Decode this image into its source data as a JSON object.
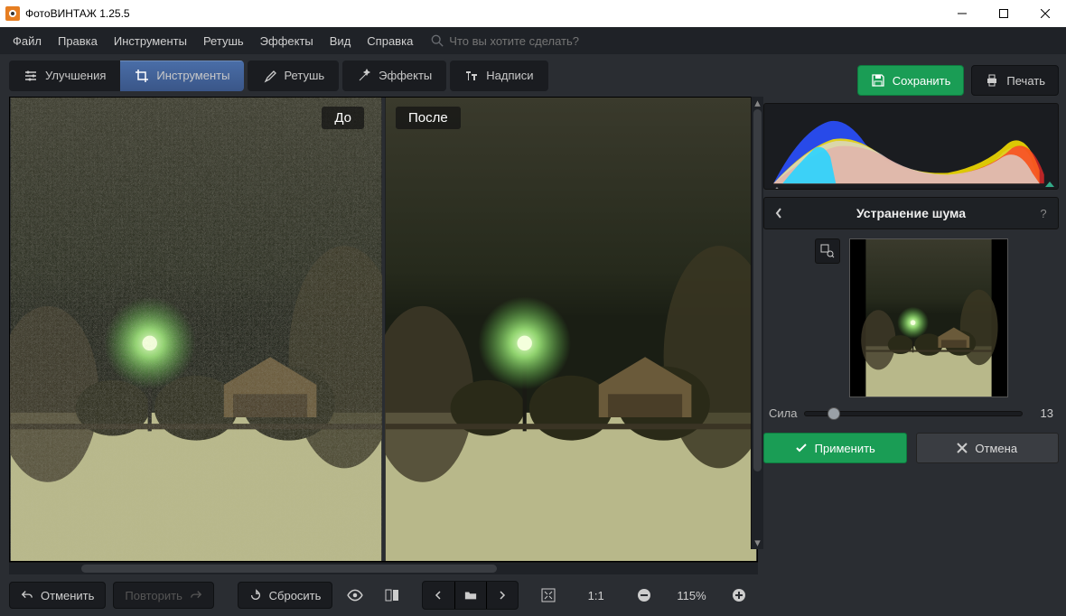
{
  "app": {
    "title": "ФотоВИНТАЖ 1.25.5"
  },
  "menu": {
    "file": "Файл",
    "edit": "Правка",
    "tools": "Инструменты",
    "retouch": "Ретушь",
    "effects": "Эффекты",
    "view": "Вид",
    "help": "Справка",
    "search_placeholder": "Что вы хотите сделать?"
  },
  "tabs": {
    "enhance": "Улучшения",
    "tools": "Инструменты",
    "retouch": "Ретушь",
    "effects": "Эффекты",
    "text": "Надписи"
  },
  "compare": {
    "before": "До",
    "after": "После"
  },
  "actions": {
    "save": "Сохранить",
    "print": "Печать"
  },
  "panel": {
    "title": "Устранение шума",
    "strength_label": "Сила",
    "strength_value": "13",
    "apply": "Применить",
    "cancel": "Отмена"
  },
  "bottom": {
    "undo": "Отменить",
    "redo": "Повторить",
    "reset": "Сбросить",
    "zoom_ratio": "1:1",
    "zoom_pct": "115%"
  }
}
